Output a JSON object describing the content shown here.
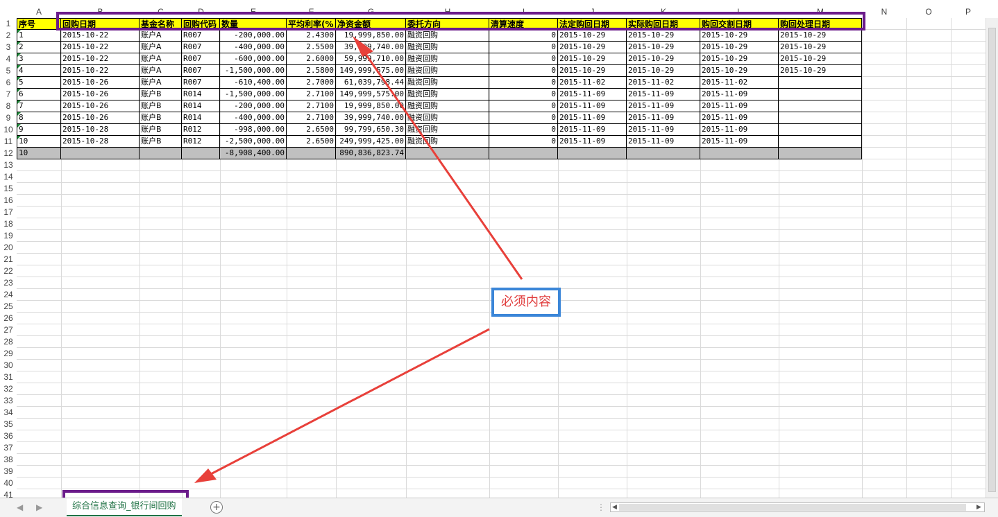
{
  "columns": [
    "A",
    "B",
    "C",
    "D",
    "E",
    "F",
    "G",
    "H",
    "I",
    "J",
    "K",
    "L",
    "M",
    "N",
    "O",
    "P"
  ],
  "rows": [
    "1",
    "2",
    "3",
    "4",
    "5",
    "6",
    "7",
    "8",
    "9",
    "10",
    "11",
    "12",
    "13",
    "14",
    "15",
    "16",
    "17",
    "18",
    "19",
    "20",
    "21",
    "22",
    "23",
    "24",
    "25",
    "26",
    "27",
    "28",
    "29",
    "30",
    "31",
    "32",
    "33",
    "34",
    "35",
    "36",
    "37",
    "38",
    "39",
    "40",
    "41"
  ],
  "headers": [
    "序号",
    "回购日期",
    "基金名称",
    "回购代码",
    "数量",
    "平均利率(%",
    "净资金额",
    "委托方向",
    "清算速度",
    "法定购回日期",
    "实际购回日期",
    "购回交割日期",
    "购回处理日期"
  ],
  "data_rows": [
    [
      "1",
      "2015-10-22",
      "账户A",
      "R007",
      "-200,000.00",
      "2.4300",
      "19,999,850.00",
      "融资回购",
      "0",
      "2015-10-29",
      "2015-10-29",
      "2015-10-29",
      "2015-10-29"
    ],
    [
      "2",
      "2015-10-22",
      "账户A",
      "R007",
      "-400,000.00",
      "2.5500",
      "39,999,740.00",
      "融资回购",
      "0",
      "2015-10-29",
      "2015-10-29",
      "2015-10-29",
      "2015-10-29"
    ],
    [
      "3",
      "2015-10-22",
      "账户A",
      "R007",
      "-600,000.00",
      "2.6000",
      "59,999,710.00",
      "融资回购",
      "0",
      "2015-10-29",
      "2015-10-29",
      "2015-10-29",
      "2015-10-29"
    ],
    [
      "4",
      "2015-10-22",
      "账户A",
      "R007",
      "-1,500,000.00",
      "2.5800",
      "149,999,575.00",
      "融资回购",
      "0",
      "2015-10-29",
      "2015-10-29",
      "2015-10-29",
      "2015-10-29"
    ],
    [
      "5",
      "2015-10-26",
      "账户A",
      "R007",
      "-610,400.00",
      "2.7000",
      "61,039,798.44",
      "融资回购",
      "0",
      "2015-11-02",
      "2015-11-02",
      "2015-11-02",
      ""
    ],
    [
      "6",
      "2015-10-26",
      "账户B",
      "R014",
      "-1,500,000.00",
      "2.7100",
      "149,999,575.00",
      "融资回购",
      "0",
      "2015-11-09",
      "2015-11-09",
      "2015-11-09",
      ""
    ],
    [
      "7",
      "2015-10-26",
      "账户B",
      "R014",
      "-200,000.00",
      "2.7100",
      "19,999,850.00",
      "融资回购",
      "0",
      "2015-11-09",
      "2015-11-09",
      "2015-11-09",
      ""
    ],
    [
      "8",
      "2015-10-26",
      "账户B",
      "R014",
      "-400,000.00",
      "2.7100",
      "39,999,740.00",
      "融资回购",
      "0",
      "2015-11-09",
      "2015-11-09",
      "2015-11-09",
      ""
    ],
    [
      "9",
      "2015-10-28",
      "账户B",
      "R012",
      "-998,000.00",
      "2.6500",
      "99,799,650.30",
      "融资回购",
      "0",
      "2015-11-09",
      "2015-11-09",
      "2015-11-09",
      ""
    ],
    [
      "10",
      "2015-10-28",
      "账户B",
      "R012",
      "-2,500,000.00",
      "2.6500",
      "249,999,425.00",
      "融资回购",
      "0",
      "2015-11-09",
      "2015-11-09",
      "2015-11-09",
      ""
    ]
  ],
  "total_row": [
    "10",
    "",
    "",
    "",
    "-8,908,400.00",
    "",
    "890,836,823.74",
    "",
    "",
    "",
    "",
    "",
    ""
  ],
  "callout_text": "必须内容",
  "sheet_tab": "综合信息查询_银行间回购",
  "add_sheet": "+",
  "nav_prev": "◀",
  "nav_next": "▶",
  "colors": {
    "header_fill": "#ffff00",
    "total_fill": "#c0c0c0",
    "highlight_border": "#6b1b8a",
    "callout_border": "#3b86d8",
    "callout_text": "#e03b3b",
    "arrow": "#e8403a",
    "tab_text": "#217346"
  }
}
